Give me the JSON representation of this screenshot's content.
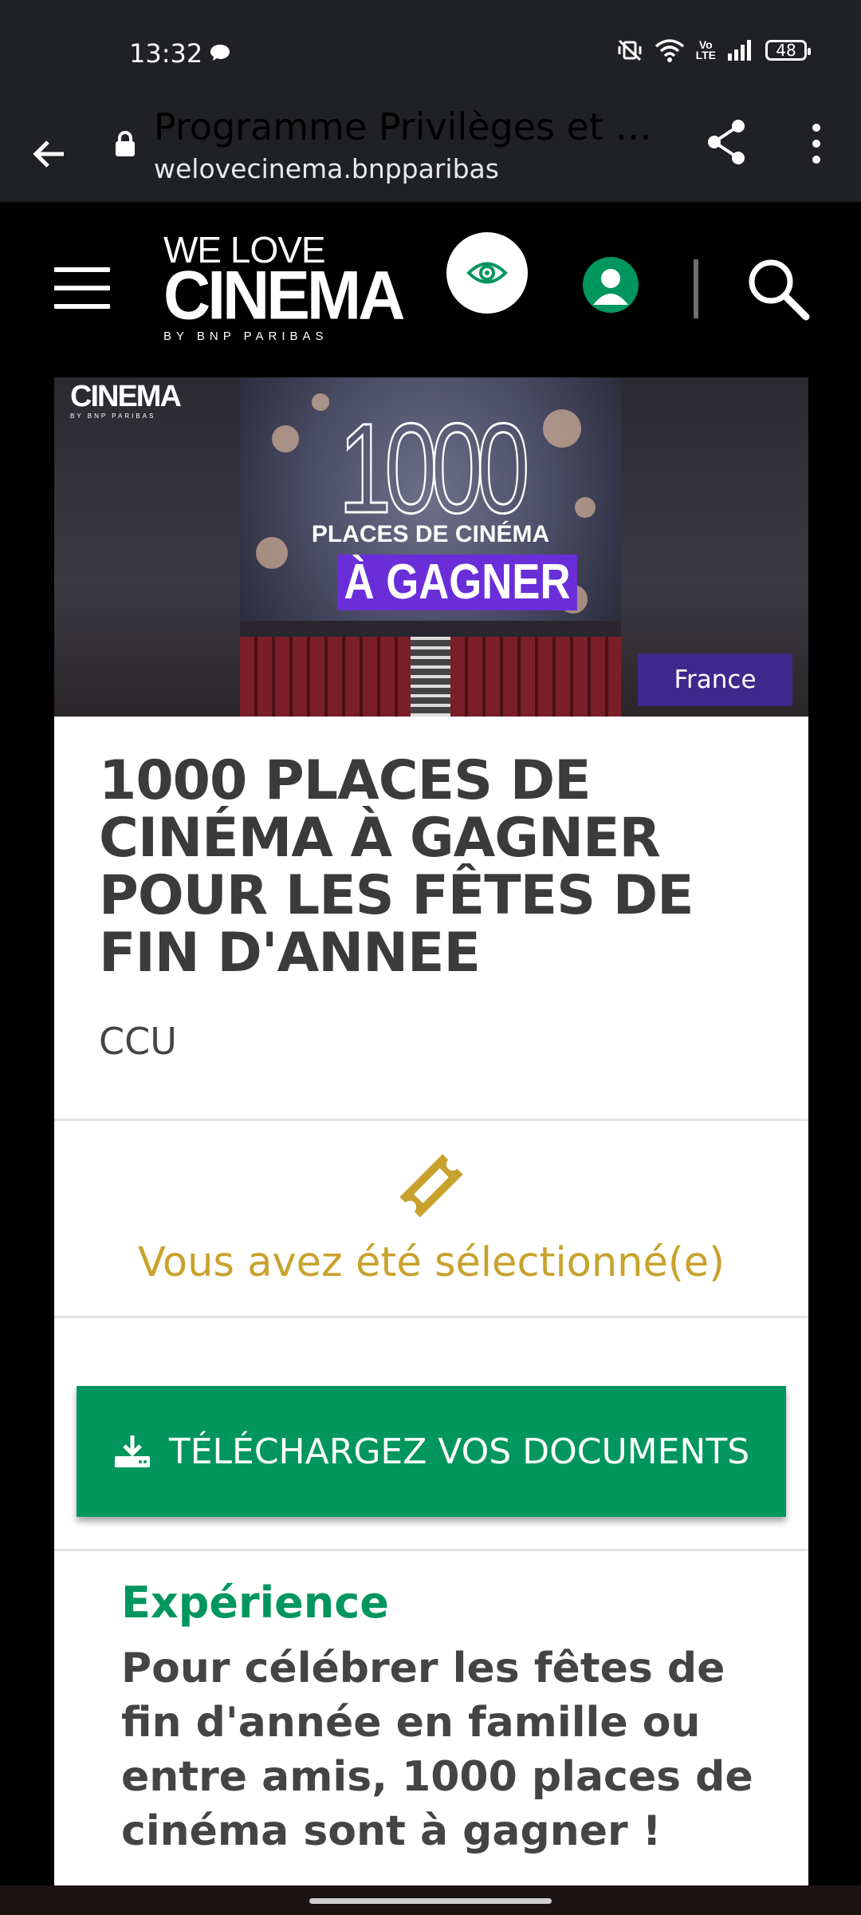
{
  "status_bar": {
    "time": "13:32",
    "battery": "48",
    "network_badge": "Vo LTE"
  },
  "browser": {
    "page_title": "Programme Privilèges et ex…",
    "domain": "welovecinema.bnpparibas"
  },
  "site": {
    "logo_line1": "WE LOVE",
    "logo_line2": "CINEMA",
    "logo_line3": "BY BNP PARIBAS"
  },
  "hero": {
    "number": "1000",
    "line1": "PLACES DE CINÉMA",
    "line2": "À GAGNER",
    "brand_small": "CINEMA",
    "brand_small_sub": "BY BNP PARIBAS",
    "country": "France"
  },
  "offer": {
    "title": "1000 PLACES DE CINÉMA À GAGNER POUR LES FÊTES DE FIN D'ANNEE",
    "subtitle": "CCU",
    "status": "Vous avez été sélectionné(e)",
    "download_label": "TÉLÉCHARGEZ VOS DOCUMENTS",
    "section_title": "Expérience",
    "section_body": "Pour célébrer les fêtes de fin d'année en famille ou entre amis, 1000 places de cinéma sont à gagner !"
  },
  "colors": {
    "brand_green": "#00965e",
    "status_gold": "#c9a22d",
    "badge_purple": "#3d2a8c"
  }
}
